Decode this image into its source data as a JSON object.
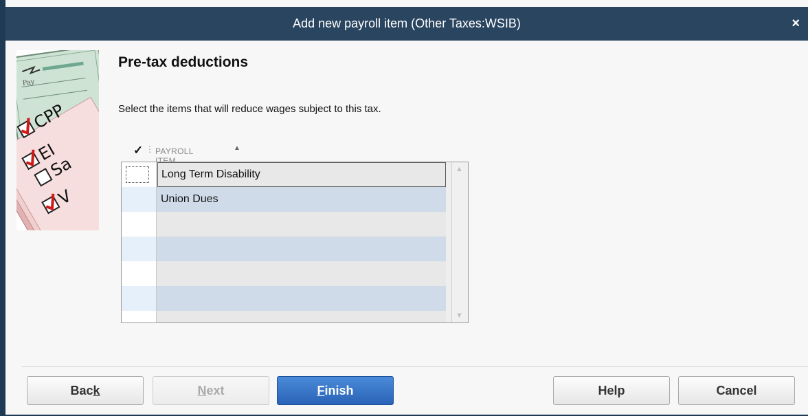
{
  "window": {
    "title": "Add new payroll item (Other Taxes:WSIB)",
    "close_glyph": "×"
  },
  "header": {
    "heading": "Pre-tax deductions",
    "instruction": "Select the items that will reduce wages subject to this tax."
  },
  "art": {
    "labels": [
      "CPP",
      "EI",
      "Sa",
      "V"
    ],
    "checked": [
      true,
      true,
      false,
      true
    ]
  },
  "table": {
    "check_column_glyph": "✓",
    "column_header": "PAYROLL ITEM",
    "sort_indicator": "▲",
    "rows": [
      {
        "checked": false,
        "name": "Long Term Disability"
      },
      {
        "checked": false,
        "name": "Union Dues"
      }
    ]
  },
  "buttons": {
    "back": {
      "pre": "Bac",
      "underline": "k",
      "post": ""
    },
    "next": {
      "pre": "",
      "underline": "N",
      "post": "ext"
    },
    "finish": {
      "pre": "",
      "underline": "F",
      "post": "inish"
    },
    "help": "Help",
    "cancel": "Cancel"
  },
  "colors": {
    "titlebar": "#2a4560",
    "primary_button": "#2a63b7",
    "row_alt": "#cfdbe9"
  }
}
